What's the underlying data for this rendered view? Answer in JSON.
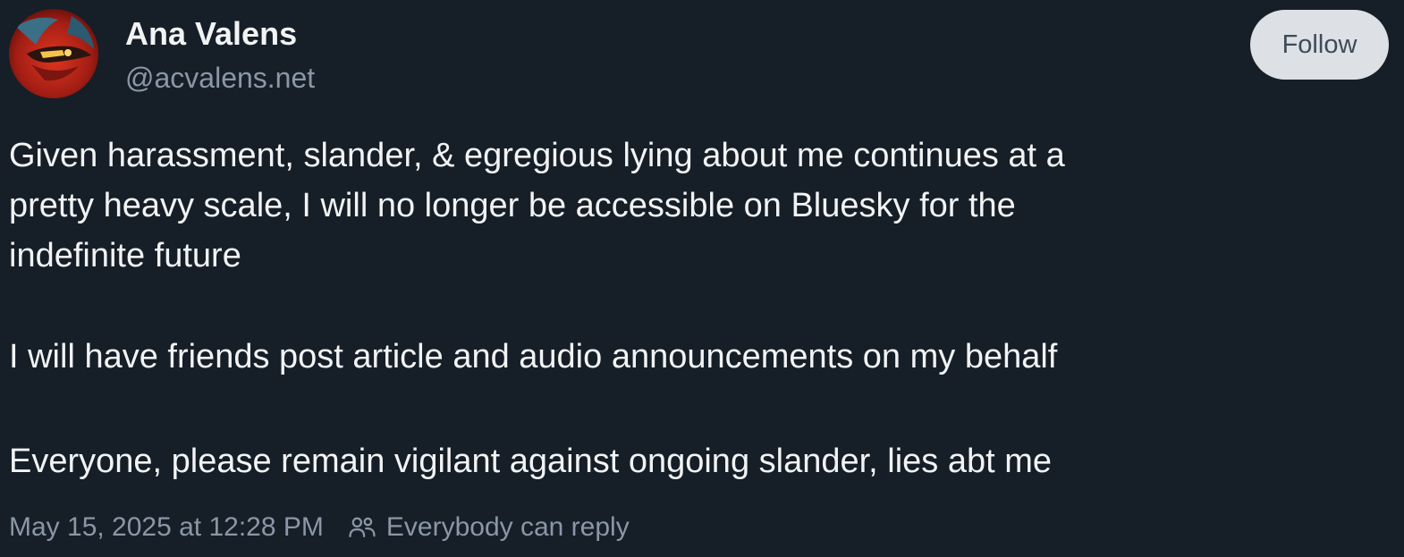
{
  "post": {
    "author": {
      "display_name": "Ana Valens",
      "handle": "@acvalens.net",
      "avatar_icon": "user-avatar"
    },
    "follow_label": "Follow",
    "text_lines": [
      "Given harassment, slander, & egregious lying about me continues at a",
      "pretty heavy scale, I will no longer be accessible on Bluesky for the",
      "indefinite future",
      "I will have friends post article and audio announcements on my behalf",
      "Everyone, please remain vigilant against ongoing slander, lies abt me"
    ],
    "timestamp": "May 15, 2025 at 12:28 PM",
    "reply_setting": "Everybody can reply",
    "reply_icon": "people-icon"
  },
  "colors": {
    "background": "#161e27",
    "text": "#f1f3f5",
    "muted": "#8a97a6",
    "follow_bg": "#dde1e6",
    "avatar_red": "#c8281c"
  }
}
